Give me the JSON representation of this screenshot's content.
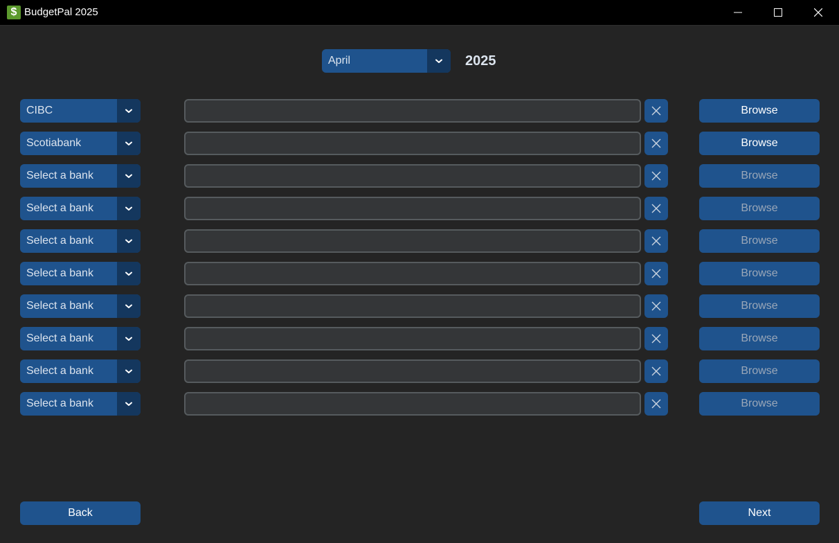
{
  "window": {
    "title": "BudgetPal 2025",
    "icon": "dollar-icon",
    "icon_glyph": "$"
  },
  "period": {
    "month": "April",
    "year": "2025"
  },
  "rows": [
    {
      "bank": "CIBC",
      "path": "",
      "browse_label": "Browse",
      "browse_enabled": true
    },
    {
      "bank": "Scotiabank",
      "path": "",
      "browse_label": "Browse",
      "browse_enabled": true
    },
    {
      "bank": "Select a bank",
      "path": "",
      "browse_label": "Browse",
      "browse_enabled": false
    },
    {
      "bank": "Select a bank",
      "path": "",
      "browse_label": "Browse",
      "browse_enabled": false
    },
    {
      "bank": "Select a bank",
      "path": "",
      "browse_label": "Browse",
      "browse_enabled": false
    },
    {
      "bank": "Select a bank",
      "path": "",
      "browse_label": "Browse",
      "browse_enabled": false
    },
    {
      "bank": "Select a bank",
      "path": "",
      "browse_label": "Browse",
      "browse_enabled": false
    },
    {
      "bank": "Select a bank",
      "path": "",
      "browse_label": "Browse",
      "browse_enabled": false
    },
    {
      "bank": "Select a bank",
      "path": "",
      "browse_label": "Browse",
      "browse_enabled": false
    },
    {
      "bank": "Select a bank",
      "path": "",
      "browse_label": "Browse",
      "browse_enabled": false
    }
  ],
  "nav": {
    "back_label": "Back",
    "next_label": "Next"
  },
  "colors": {
    "background": "#242424",
    "button": "#1f538d",
    "button_dark": "#14375e",
    "entry_bg": "#343638",
    "entry_border": "#565b5e",
    "text": "#dce4ee",
    "disabled_text": "#9aa7b8"
  }
}
